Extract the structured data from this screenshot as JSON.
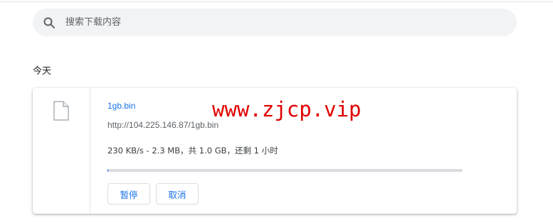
{
  "search": {
    "placeholder": "搜索下载内容",
    "value": ""
  },
  "section": {
    "title": "今天"
  },
  "download": {
    "file_name": "1gb.bin",
    "url": "http://104.225.146.87/1gb.bin",
    "status": "230 KB/s - 2.3 MB，共 1.0 GB，还剩 1 小时",
    "progress_fraction": 0.0023,
    "pause_label": "暂停",
    "cancel_label": "取消"
  },
  "watermark": {
    "text": "www.zjcp.vip"
  },
  "icons": {
    "search": "search-icon",
    "file": "file-icon"
  },
  "colors": {
    "accent": "#1a73e8",
    "watermark": "#e00000",
    "search_bg": "#f1f3f4"
  }
}
